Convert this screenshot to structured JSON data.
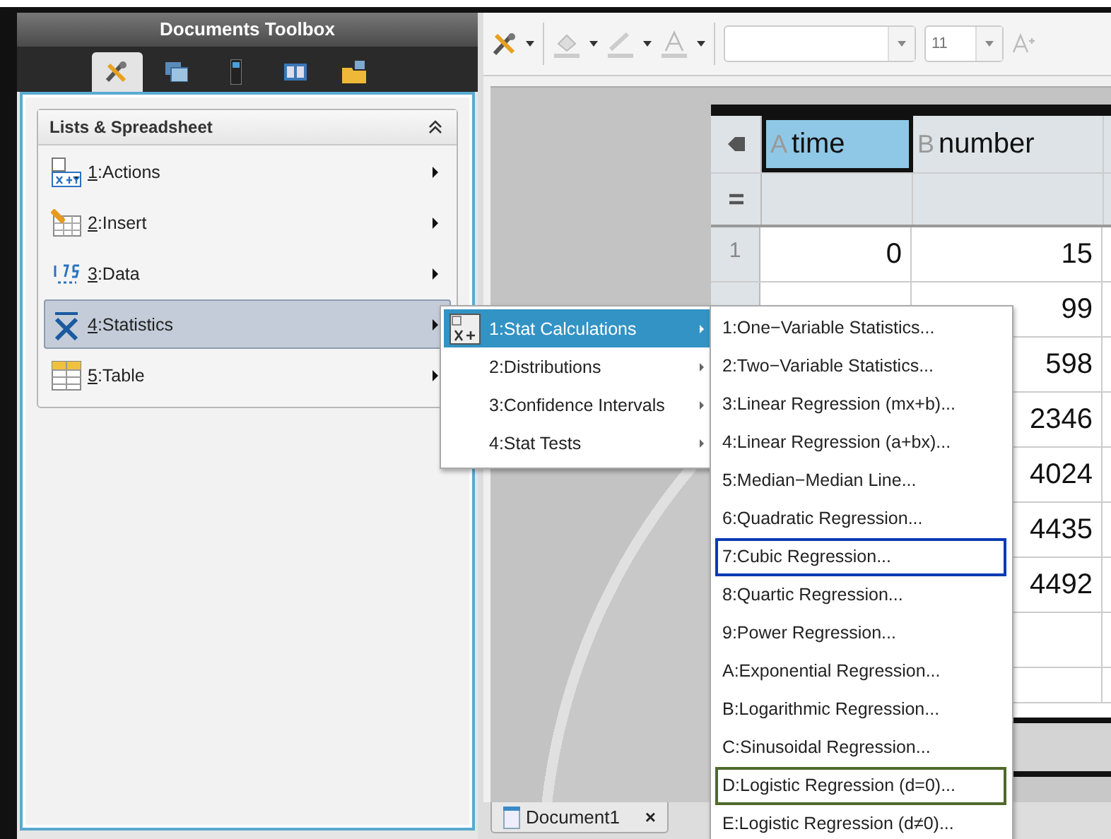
{
  "toolbox": {
    "title": "Documents Toolbox",
    "tabs": [
      {
        "kind": "tools",
        "selected": true
      },
      {
        "kind": "graphs",
        "selected": false
      },
      {
        "kind": "device",
        "selected": false
      },
      {
        "kind": "book",
        "selected": false
      },
      {
        "kind": "folder",
        "selected": false
      }
    ]
  },
  "panel": {
    "title": "Lists & Spreadsheet",
    "items": [
      {
        "kind": "actions",
        "key": "1",
        "text": ":Actions",
        "selected": false
      },
      {
        "kind": "insert",
        "key": "2",
        "text": ":Insert",
        "selected": false
      },
      {
        "kind": "data",
        "key": "3",
        "text": ":Data",
        "selected": false
      },
      {
        "kind": "statistics",
        "key": "4",
        "text": ":Statistics",
        "selected": true
      },
      {
        "kind": "table",
        "key": "5",
        "text": ":Table",
        "selected": false
      }
    ]
  },
  "toolbar": {
    "font_size": "11"
  },
  "table": {
    "columns": [
      {
        "letter": "A",
        "name": "time",
        "selected": true
      },
      {
        "letter": "B",
        "name": "number",
        "selected": false
      }
    ],
    "rows": [
      {
        "num": "1",
        "cells": [
          "0",
          "15"
        ]
      },
      {
        "num": "",
        "cells": [
          "",
          "99"
        ]
      },
      {
        "num": "",
        "cells": [
          "",
          "598"
        ]
      },
      {
        "num": "",
        "cells": [
          "",
          "2346"
        ]
      },
      {
        "num": "",
        "cells": [
          "",
          "4024"
        ]
      },
      {
        "num": "",
        "cells": [
          "",
          "4435"
        ]
      },
      {
        "num": "",
        "cells": [
          "",
          "4492"
        ]
      }
    ]
  },
  "document_tab": {
    "label": "Document1",
    "close": "×"
  },
  "stat_menu": {
    "items": [
      {
        "label": "1:Stat Calculations",
        "selected": true
      },
      {
        "label": "2:Distributions",
        "selected": false
      },
      {
        "label": "3:Confidence Intervals",
        "selected": false
      },
      {
        "label": "4:Stat Tests",
        "selected": false
      }
    ]
  },
  "calc_menu": {
    "items": [
      {
        "label": "1:One−Variable Statistics..."
      },
      {
        "label": "2:Two−Variable Statistics..."
      },
      {
        "label": "3:Linear Regression (mx+b)..."
      },
      {
        "label": "4:Linear Regression (a+bx)..."
      },
      {
        "label": "5:Median−Median Line..."
      },
      {
        "label": "6:Quadratic Regression..."
      },
      {
        "label": "7:Cubic Regression...",
        "color": "#0a3bb5"
      },
      {
        "label": "8:Quartic Regression..."
      },
      {
        "label": "9:Power Regression..."
      },
      {
        "label": "A:Exponential Regression..."
      },
      {
        "label": "B:Logarithmic Regression..."
      },
      {
        "label": "C:Sinusoidal Regression..."
      },
      {
        "label": "D:Logistic Regression (d=0)...",
        "color": "#4f6a2c"
      },
      {
        "label": "E:Logistic Regression (d≠0)..."
      }
    ]
  }
}
